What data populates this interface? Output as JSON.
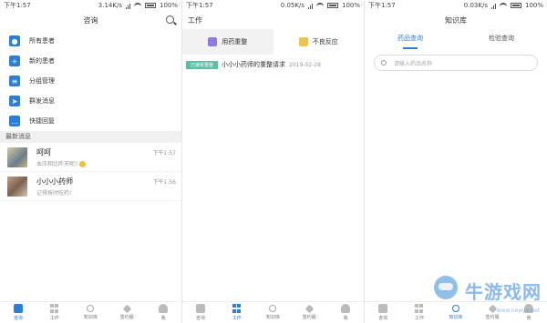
{
  "status": {
    "time": "下午1:57",
    "screens": [
      {
        "speed": "3.14K/s",
        "battery": "100%"
      },
      {
        "speed": "0.05K/s",
        "battery": "100%"
      },
      {
        "speed": "0.03K/s",
        "battery": "100%"
      }
    ]
  },
  "consult": {
    "title": "咨询",
    "menu": [
      {
        "label": "所有患者",
        "icon": "patients-icon"
      },
      {
        "label": "新的患者",
        "icon": "plus-icon"
      },
      {
        "label": "分组管理",
        "icon": "list-icon"
      },
      {
        "label": "群发消息",
        "icon": "send-icon"
      },
      {
        "label": "快捷回复",
        "icon": "chat-icon"
      }
    ],
    "recent_label": "最新消息",
    "messages": [
      {
        "name": "呵呵",
        "text": "血压相比昨天呢?",
        "time": "下午1:57"
      },
      {
        "name": "小小小药师",
        "text": "记得按时吃药!",
        "time": "下午1:56"
      }
    ]
  },
  "work": {
    "title": "工作",
    "cards": [
      {
        "label": "用药重整",
        "icon": "medication-icon",
        "color": "#8f7be0"
      },
      {
        "label": "不良反应",
        "icon": "reaction-icon",
        "color": "#f0c44a"
      }
    ],
    "request": {
      "tag": "已接受重整",
      "title": "小小小药师的重整请求",
      "date": "2019-02-28"
    }
  },
  "kb": {
    "title": "知识库",
    "tabs": [
      "药品查询",
      "检验查询"
    ],
    "search_placeholder": "请输入药品名称"
  },
  "tabbar": [
    "咨询",
    "工作",
    "知识库",
    "签约服",
    "我"
  ],
  "watermark": {
    "text": "牛游戏网",
    "url": "www.newyx.net"
  },
  "colors": {
    "accent": "#2b7fd9",
    "tag_green": "#5cbfa5"
  }
}
